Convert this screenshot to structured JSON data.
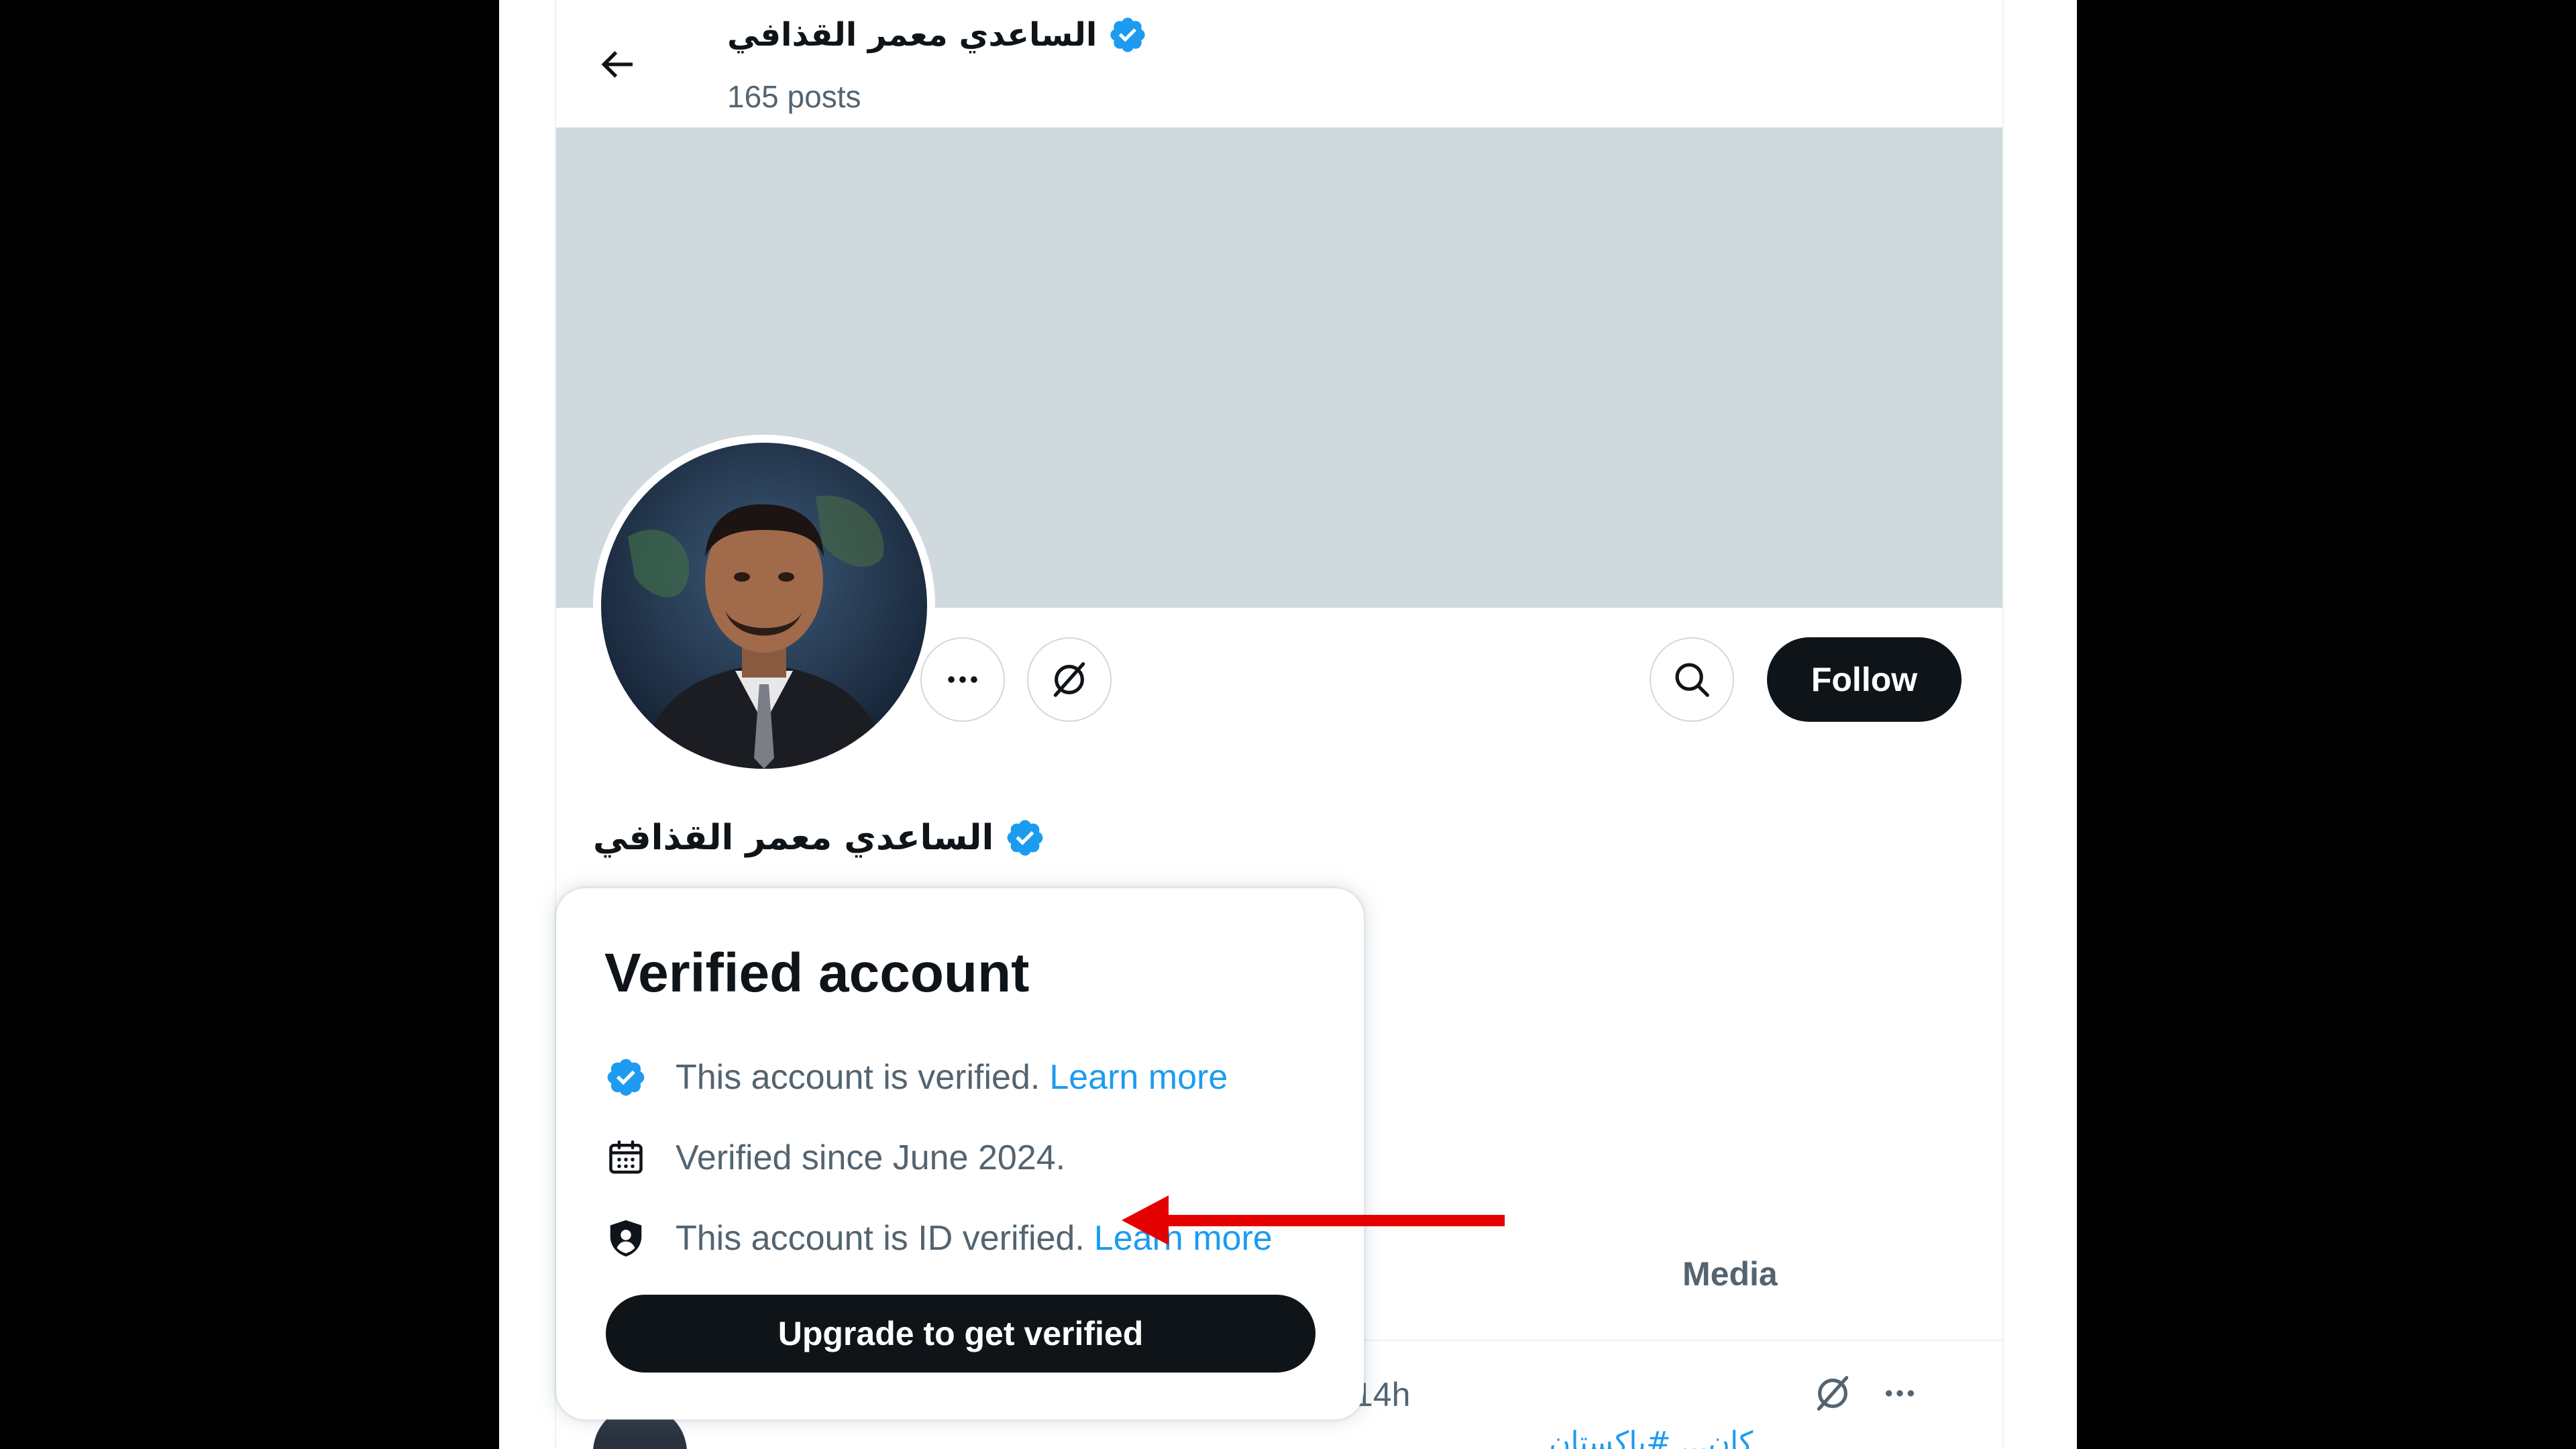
{
  "header": {
    "display_name": "الساعدي معمر القذافي",
    "post_count": "165 posts"
  },
  "profile": {
    "display_name": "الساعدي معمر القذافي",
    "follow_label": "Follow"
  },
  "tabs": {
    "media_label": "Media"
  },
  "post": {
    "time": "14h",
    "text_preview": "كان... #باكستان"
  },
  "popover": {
    "title": "Verified account",
    "verified_text": "This account is verified.",
    "learn_more": "Learn more",
    "since_text": "Verified since June 2024.",
    "id_text": "This account is ID verified.",
    "id_learn_more": "Learn more",
    "upgrade_label": "Upgrade to get verified"
  },
  "colors": {
    "verified_badge": "#1d9bf0",
    "follow_button": "#0f1419",
    "banner": "#cfd9de",
    "annotation_arrow": "#e50000"
  },
  "icons": [
    "back-arrow-icon",
    "verified-badge-icon",
    "more-icon",
    "grok-icon",
    "search-icon",
    "calendar-icon",
    "shield-icon"
  ]
}
